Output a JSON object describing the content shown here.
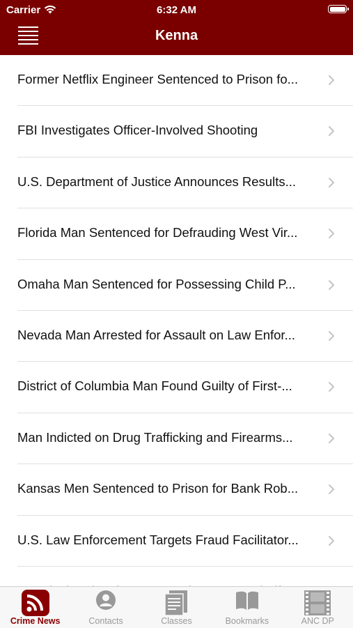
{
  "status_bar": {
    "carrier": "Carrier",
    "time": "6:32 AM"
  },
  "nav": {
    "title": "Kenna"
  },
  "list": {
    "items": [
      {
        "label": "Former Netflix Engineer Sentenced to Prison fo..."
      },
      {
        "label": "FBI Investigates Officer-Involved Shooting"
      },
      {
        "label": "U.S. Department of Justice Announces Results..."
      },
      {
        "label": "Florida Man Sentenced for Defrauding West Vir..."
      },
      {
        "label": "Omaha Man Sentenced for Possessing Child P..."
      },
      {
        "label": "Nevada Man Arrested for Assault on Law Enfor..."
      },
      {
        "label": "District of Columbia Man Found Guilty of First-..."
      },
      {
        "label": "Man Indicted on Drug Trafficking and Firearms..."
      },
      {
        "label": "Kansas Men Sentenced to Prison for Bank Rob..."
      },
      {
        "label": "U.S. Law Enforcement Targets Fraud Facilitator..."
      },
      {
        "label": "FBI Pittsburgh Joins Community Groups Clarify..."
      }
    ]
  },
  "tabbar": {
    "tabs": [
      {
        "label": "Crime News",
        "icon": "rss-icon",
        "active": true
      },
      {
        "label": "Contacts",
        "icon": "person-icon",
        "active": false
      },
      {
        "label": "Classes",
        "icon": "document-icon",
        "active": false
      },
      {
        "label": "Bookmarks",
        "icon": "book-icon",
        "active": false
      },
      {
        "label": "ANC DP",
        "icon": "film-icon",
        "active": false
      }
    ]
  },
  "colors": {
    "nav_bg": "#7a0000",
    "active_tab": "#8a0000",
    "inactive_tab": "#999999"
  }
}
